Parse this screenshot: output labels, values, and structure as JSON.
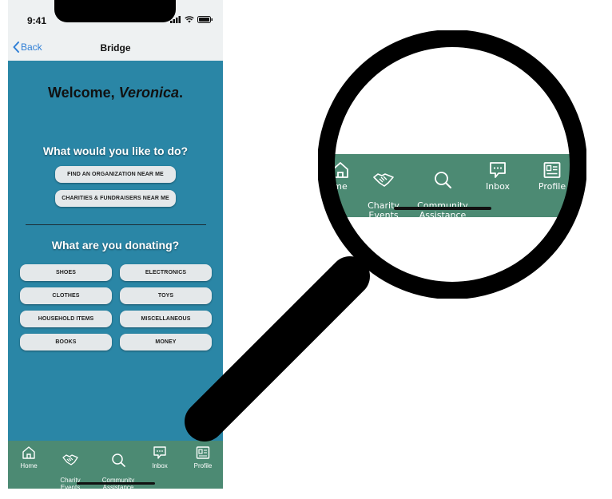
{
  "status": {
    "time": "9:41"
  },
  "nav": {
    "back_label": "Back",
    "title": "Bridge"
  },
  "welcome": {
    "prefix": "Welcome, ",
    "name": "Veronica",
    "suffix": "."
  },
  "do_section": {
    "question": "What would you like to do?",
    "buttons": [
      "FIND AN ORGANIZATION NEAR ME",
      "CHARITIES & FUNDRAISERS NEAR ME"
    ]
  },
  "donate_section": {
    "question": "What are you donating?",
    "options": [
      "SHOES",
      "ELECTRONICS",
      "CLOTHES",
      "TOYS",
      "HOUSEHOLD ITEMS",
      "MISCELLANEOUS",
      "BOOKS",
      "MONEY"
    ]
  },
  "tabbar": {
    "items": [
      {
        "label": "Home",
        "icon": "home-icon"
      },
      {
        "label": "Charity\nEvents",
        "icon": "handshake-icon"
      },
      {
        "label": "Community\nAssistance",
        "icon": "search-icon"
      },
      {
        "label": "Inbox",
        "icon": "chat-icon"
      },
      {
        "label": "Profile",
        "icon": "profile-card-icon"
      }
    ]
  },
  "magnified": {
    "items": [
      {
        "label": "me",
        "icon": "home-icon"
      },
      {
        "label": "Charity\nEvents",
        "icon": "handshake-icon"
      },
      {
        "label": "Community\nAssistance",
        "icon": "search-icon"
      },
      {
        "label": "Inbox",
        "icon": "chat-icon"
      },
      {
        "label": "Profile",
        "icon": "profile-card-icon"
      }
    ]
  },
  "colors": {
    "background": "#2A86A6",
    "tabbar": "#4C8A73",
    "header": "#EEF1F2",
    "pill": "#E4E8EA",
    "link": "#2F7FD6"
  }
}
